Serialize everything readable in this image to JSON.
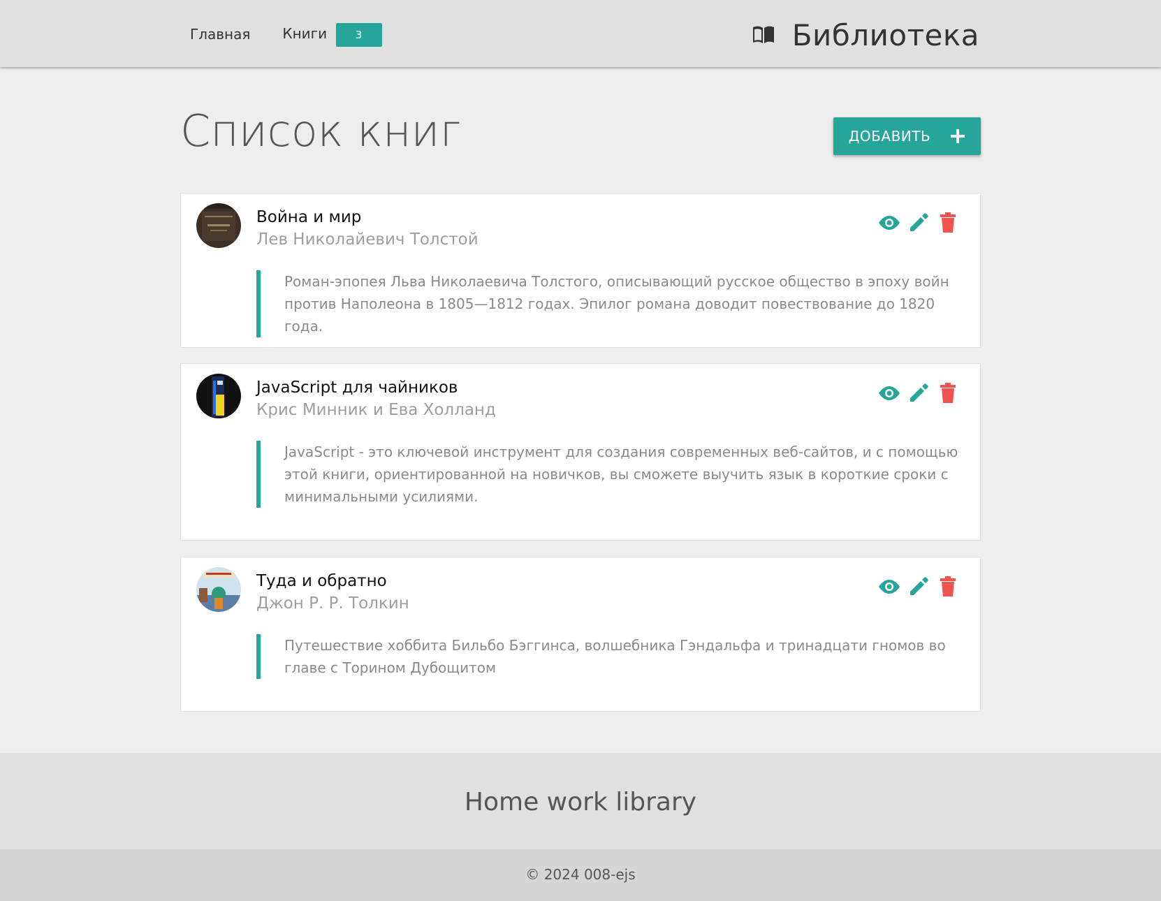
{
  "nav": {
    "home_label": "Главная",
    "books_label": "Книги",
    "books_count": "3",
    "brand_icon": "open-book-icon",
    "brand_title": "Библиотека"
  },
  "main": {
    "title": "Список книг",
    "add_label": "ДОБАВИТЬ",
    "add_icon": "plus-icon"
  },
  "books": [
    {
      "title": "Война и мир",
      "author": "Лев Николайевич Толстой",
      "description": "Роман-эпопея Льва Николаевича Толстого, описывающий русское общество в эпоху войн против Наполеона в 1805—1812 годах. Эпилог романа доводит повествование до 1820 года."
    },
    {
      "title": "JavaScript для чайников",
      "author": "Крис Минник и Ева Холланд",
      "description": "JavaScript - это ключевой инструмент для создания современных веб-сайтов, и с помощью этой книги, ориентированной на новичков, вы сможете выучить язык в короткие сроки с минимальными усилиями."
    },
    {
      "title": "Туда и обратно",
      "author": "Джон Р. Р. Толкин",
      "description": "Путешествие хоббита Бильбо Бэггинса, волшебника Гэндальфа и тринадцати гномов во главе с Торином Дубощитом"
    }
  ],
  "actions": {
    "view_icon": "eye-icon",
    "edit_icon": "pencil-icon",
    "delete_icon": "trash-icon"
  },
  "colors": {
    "accent": "#26a69a",
    "danger": "#ef5350",
    "navbar_bg": "#e0e0e0",
    "page_bg": "#eeeeee"
  },
  "footer": {
    "title": "Home work library",
    "copyright": "© 2024 008-ejs"
  }
}
